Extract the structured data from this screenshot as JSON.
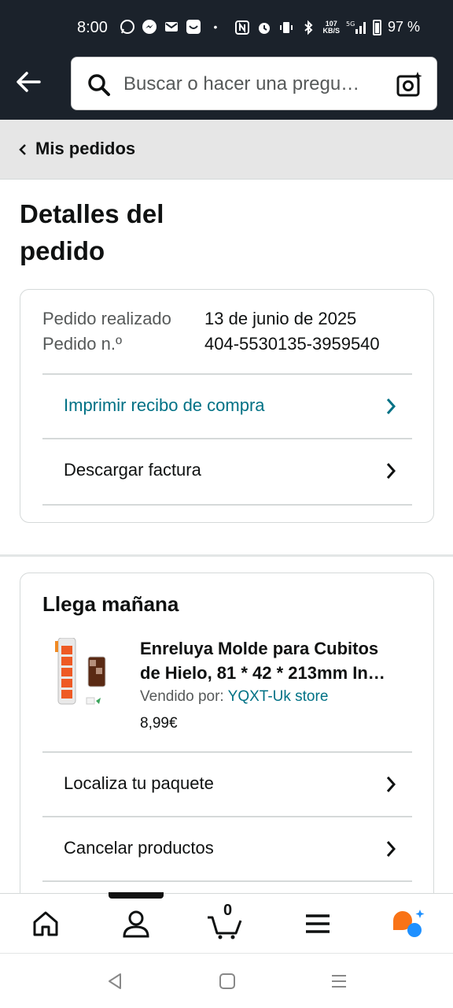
{
  "status_bar": {
    "time": "8:00",
    "net_speed_top": "107",
    "net_speed_unit": "KB/S",
    "network": "5G",
    "battery": "97 %"
  },
  "search": {
    "placeholder": "Buscar o hacer una pregu…"
  },
  "breadcrumb": {
    "label": "Mis pedidos"
  },
  "page": {
    "title": "Detalles del pedido"
  },
  "order_info": {
    "placed_label": "Pedido realizado",
    "placed_value": "13 de junio de 2025",
    "number_label": "Pedido n.º",
    "number_value": "404-5530135-3959540",
    "print_receipt": "Imprimir recibo de compra",
    "download_invoice": "Descargar factura"
  },
  "shipment": {
    "title": "Llega mañana",
    "product_title_line1": "Enreluya Molde para Cubitos",
    "product_title_line2": "de Hielo, 81 * 42 * 213mm In…",
    "seller_label": "Vendido por:",
    "seller_name": "YQXT-Uk store",
    "price": "8,99€",
    "track_label": "Localiza tu paquete",
    "cancel_label": "Cancelar productos"
  },
  "bottom_nav": {
    "cart_count": "0"
  },
  "colors": {
    "header_bg": "#1b222b",
    "link": "#007185",
    "rufus_orange": "#f97316",
    "rufus_blue": "#1e90ff"
  }
}
